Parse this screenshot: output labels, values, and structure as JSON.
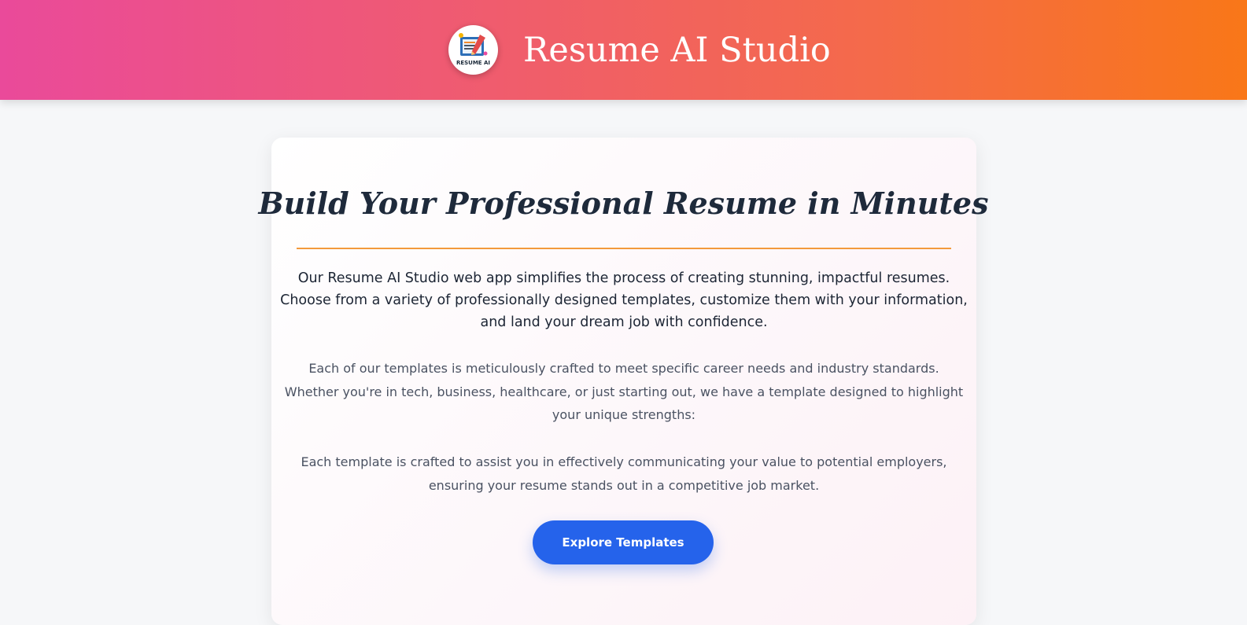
{
  "header": {
    "title": "Resume AI Studio",
    "logo_text": "RESUME AI"
  },
  "hero": {
    "heading": "Build Your Professional Resume in Minutes",
    "intro": "Our Resume AI Studio web app simplifies the process of creating stunning, impactful resumes. Choose from a variety of professionally designed templates, customize them with your information, and land your dream job with confidence.",
    "paragraph_1": "Each of our templates is meticulously crafted to meet specific career needs and industry standards. Whether you're in tech, business, healthcare, or just starting out, we have a template designed to highlight your unique strengths:",
    "paragraph_2": "Each template is crafted to assist you in effectively communicating your value to potential employers, ensuring your resume stands out in a competitive job market.",
    "cta_label": "Explore Templates"
  },
  "colors": {
    "header_gradient_start": "#ea4a9a",
    "header_gradient_end": "#f97718",
    "heading_text": "#1e2a3b",
    "divider": "#f39a3c",
    "cta_background": "#2563eb",
    "page_background": "#f6f7f9"
  }
}
